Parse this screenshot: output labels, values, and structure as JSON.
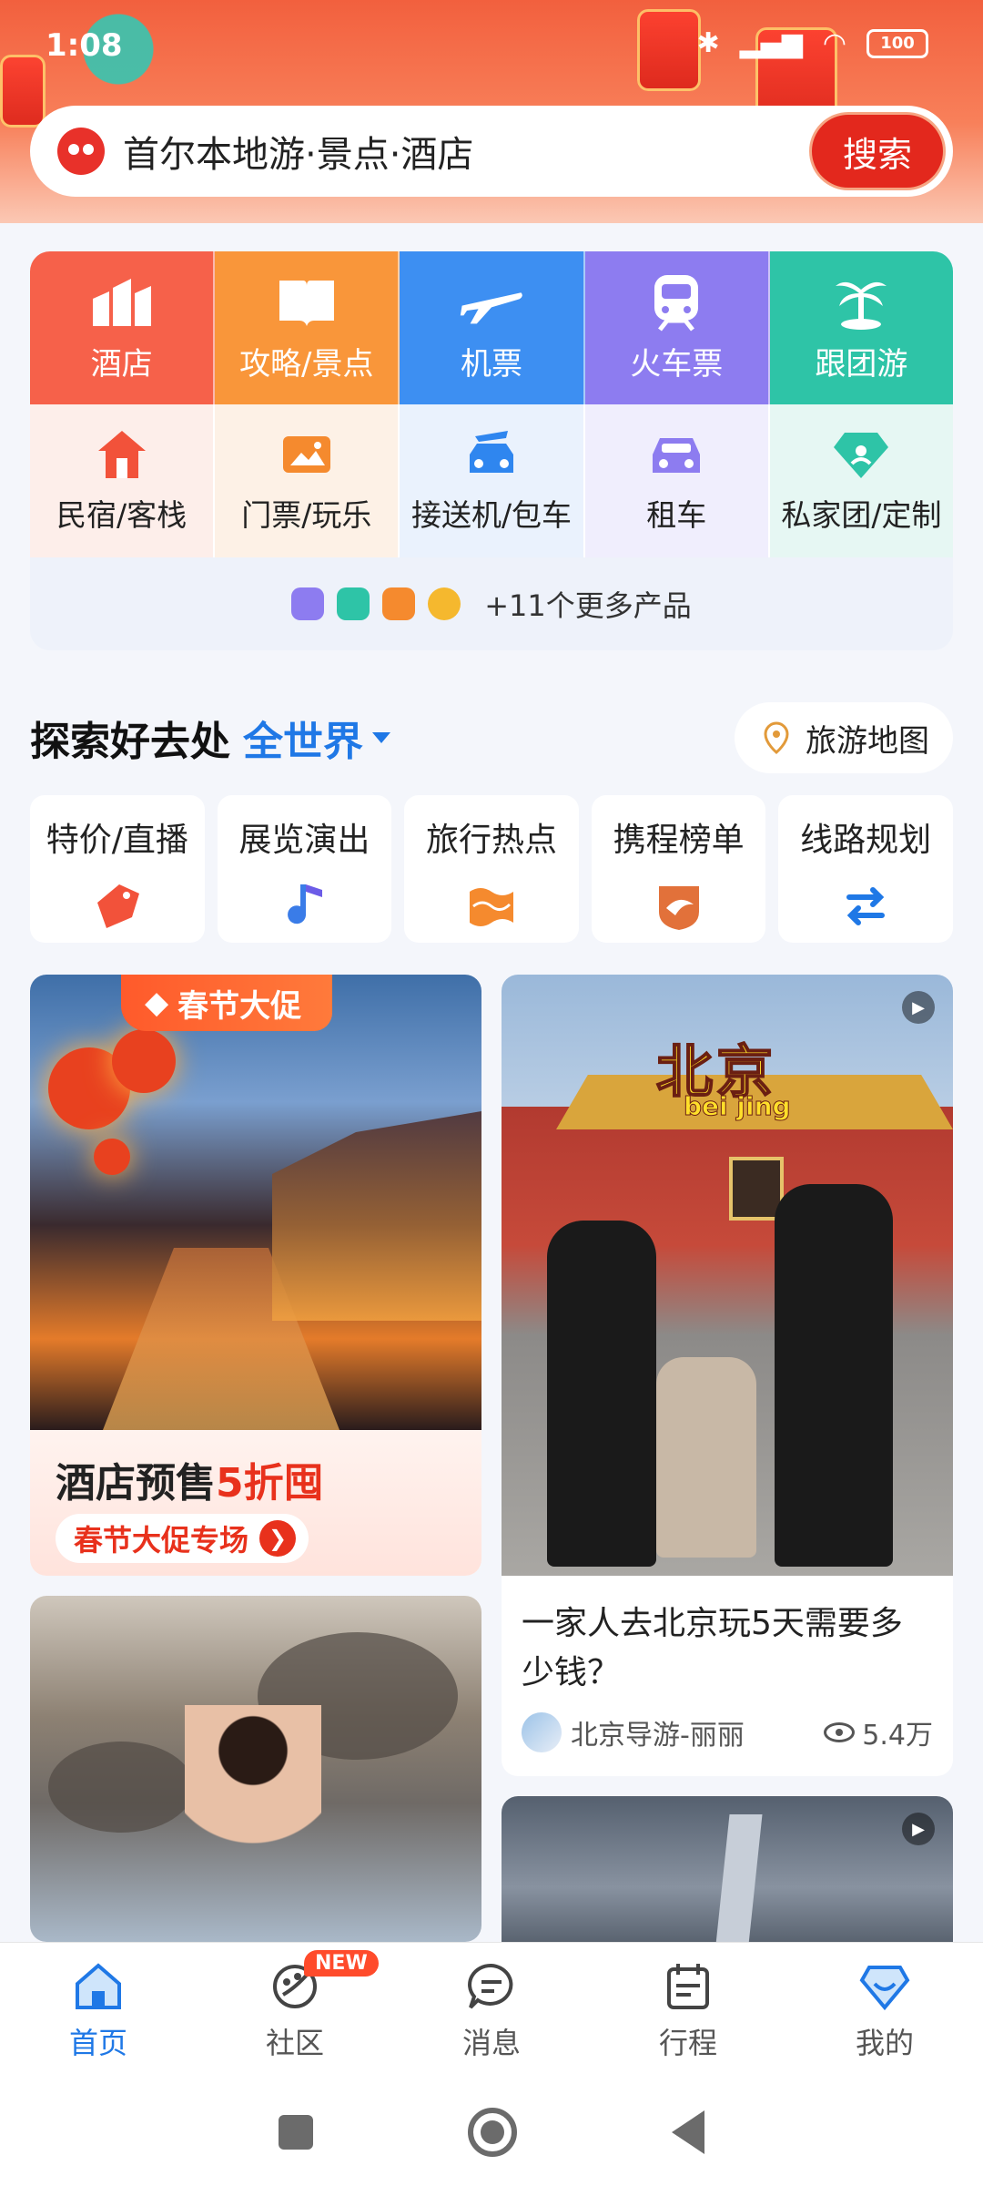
{
  "status_bar": {
    "time": "1:08",
    "battery": "100"
  },
  "search": {
    "placeholder": "首尔本地游·景点·酒店",
    "button": "搜索"
  },
  "services": {
    "main": [
      {
        "label": "酒店",
        "icon": "hotel-icon",
        "color": "#f6614a"
      },
      {
        "label": "攻略/景点",
        "icon": "guidebook-icon",
        "color": "#f9963a"
      },
      {
        "label": "机票",
        "icon": "plane-icon",
        "color": "#3d8ff2"
      },
      {
        "label": "火车票",
        "icon": "train-icon",
        "color": "#8d7cf0"
      },
      {
        "label": "跟团游",
        "icon": "palm-icon",
        "color": "#2ec4a7"
      }
    ],
    "sub": [
      {
        "label": "民宿/客栈",
        "icon": "house-icon"
      },
      {
        "label": "门票/玩乐",
        "icon": "ticket-icon"
      },
      {
        "label": "接送机/包车",
        "icon": "car-pickup-icon"
      },
      {
        "label": "租车",
        "icon": "car-rental-icon"
      },
      {
        "label": "私家团/定制",
        "icon": "diamond-icon"
      }
    ],
    "more": "+11个更多产品"
  },
  "explore": {
    "title": "探索好去处",
    "scope": "全世界",
    "map_button": "旅游地图",
    "topics": [
      {
        "label": "特价/直播",
        "icon": "price-tag-icon"
      },
      {
        "label": "展览演出",
        "icon": "music-note-icon"
      },
      {
        "label": "旅行热点",
        "icon": "flag-wave-icon"
      },
      {
        "label": "携程榜单",
        "icon": "dolphin-badge-icon"
      },
      {
        "label": "线路规划",
        "icon": "route-icon"
      }
    ]
  },
  "feed": {
    "promo": {
      "badge": "春节大促",
      "title_prefix": "酒店预售",
      "title_highlight": "5折囤",
      "cta": "春节大促专场"
    },
    "beijing": {
      "overlay_title": "北京",
      "overlay_sub": "bei jing",
      "caption": "一家人去北京玩5天需要多少钱？",
      "author": "北京导游-丽丽",
      "views": "5.4万"
    }
  },
  "bottom_nav": {
    "items": [
      {
        "label": "首页",
        "icon": "home-icon",
        "active": true
      },
      {
        "label": "社区",
        "icon": "community-icon",
        "badge": "NEW"
      },
      {
        "label": "消息",
        "icon": "message-icon"
      },
      {
        "label": "行程",
        "icon": "itinerary-icon"
      },
      {
        "label": "我的",
        "icon": "profile-icon"
      }
    ]
  },
  "colors": {
    "accent": "#1f78e6",
    "brand_red": "#e3281d"
  }
}
